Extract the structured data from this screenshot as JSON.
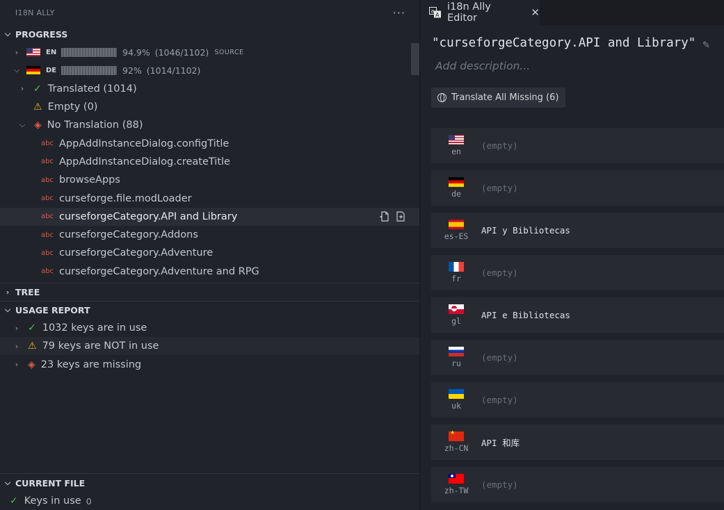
{
  "sidebar": {
    "title": "I18N ALLY",
    "more": "···",
    "progress": {
      "heading": "PROGRESS",
      "languages": [
        {
          "code": "EN",
          "percent": "94.9%",
          "ratio": "(1046/1102)",
          "tag": "SOURCE"
        },
        {
          "code": "DE",
          "percent": "92%",
          "ratio": "(1014/1102)",
          "tag": ""
        }
      ],
      "translated": "Translated (1014)",
      "empty": "Empty (0)",
      "no_translation": "No Translation (88)",
      "badge": "abc",
      "keys": [
        "AppAddInstanceDialog.configTitle",
        "AppAddInstanceDialog.createTitle",
        "browseApps",
        "curseforge.file.modLoader",
        "curseforgeCategory.API and Library",
        "curseforgeCategory.Addons",
        "curseforgeCategory.Adventure",
        "curseforgeCategory.Adventure and RPG"
      ]
    },
    "tree": {
      "heading": "TREE"
    },
    "usage": {
      "heading": "USAGE REPORT",
      "in_use": "1032 keys are in use",
      "not_in_use": "79 keys are NOT in use",
      "missing": "23 keys are missing"
    },
    "current_file": {
      "heading": "CURRENT FILE",
      "keys_in_use": "Keys in use",
      "count": "0"
    }
  },
  "editor": {
    "tab_label": "i18n Ally Editor",
    "key_title": "\"curseforgeCategory.API and Library\"",
    "description_placeholder": "Add description...",
    "translate_button": "Translate All Missing (6)",
    "locales": [
      {
        "code": "en",
        "value": "(empty)",
        "flag": "us",
        "empty": true
      },
      {
        "code": "de",
        "value": "(empty)",
        "flag": "de",
        "empty": true
      },
      {
        "code": "es-ES",
        "value": "API y Bibliotecas",
        "flag": "es",
        "empty": false
      },
      {
        "code": "fr",
        "value": "(empty)",
        "flag": "fr",
        "empty": true
      },
      {
        "code": "gl",
        "value": "API e Bibliotecas",
        "flag": "gl",
        "empty": false
      },
      {
        "code": "ru",
        "value": "(empty)",
        "flag": "ru",
        "empty": true
      },
      {
        "code": "uk",
        "value": "(empty)",
        "flag": "uk",
        "empty": true
      },
      {
        "code": "zh-CN",
        "value": "API 和库",
        "flag": "cn",
        "empty": false
      },
      {
        "code": "zh-TW",
        "value": "(empty)",
        "flag": "tw",
        "empty": true
      }
    ]
  }
}
